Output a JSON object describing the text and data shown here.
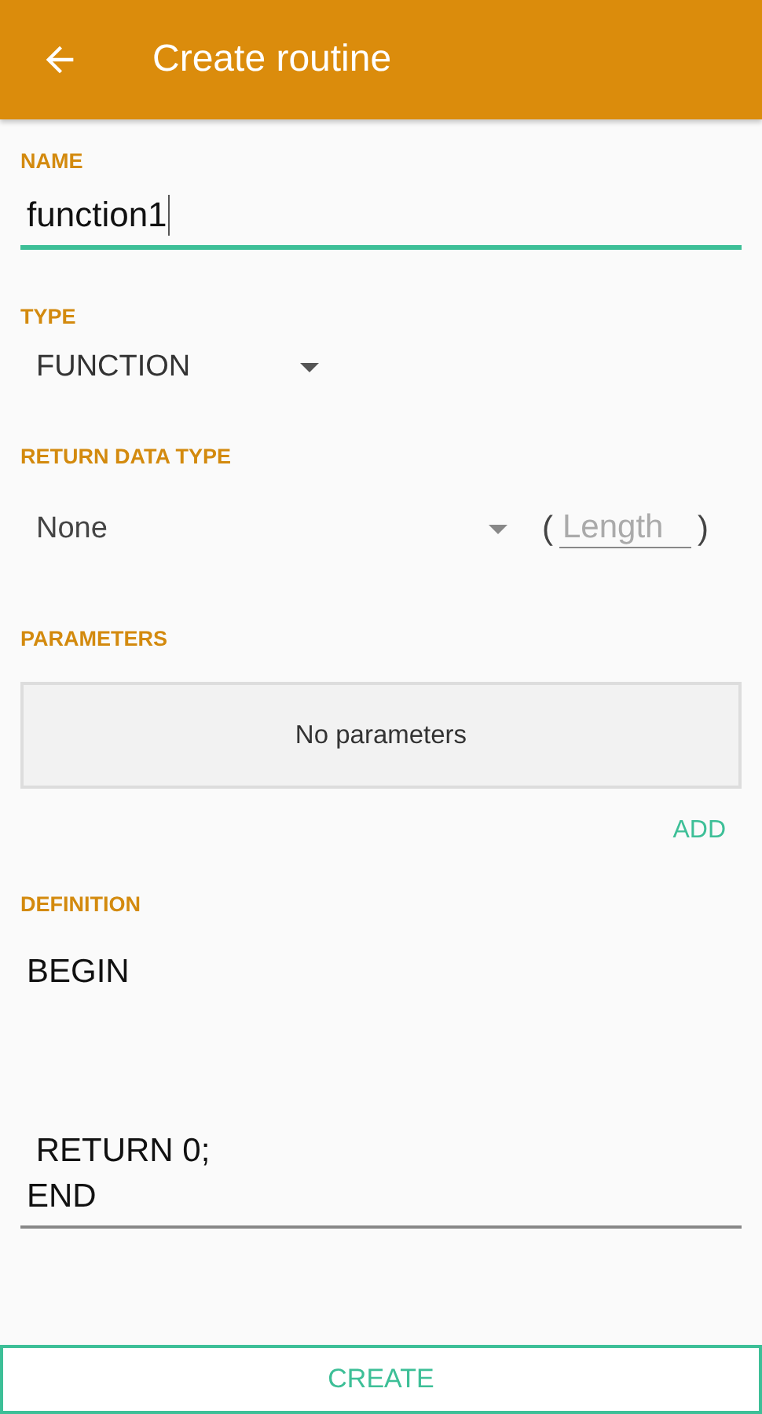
{
  "app_bar": {
    "title": "Create routine"
  },
  "name": {
    "label": "NAME",
    "value": "function1"
  },
  "type": {
    "label": "TYPE",
    "value": "FUNCTION"
  },
  "return_type": {
    "label": "RETURN DATA TYPE",
    "value": "None",
    "open_paren": "(",
    "length_placeholder": "Length",
    "close_paren": ")"
  },
  "parameters": {
    "label": "PARAMETERS",
    "empty_text": "No parameters",
    "add_button": "ADD"
  },
  "definition": {
    "label": "DEFINITION",
    "value": "BEGIN\n\n\n\n RETURN 0;\nEND"
  },
  "create_button": "CREATE"
}
